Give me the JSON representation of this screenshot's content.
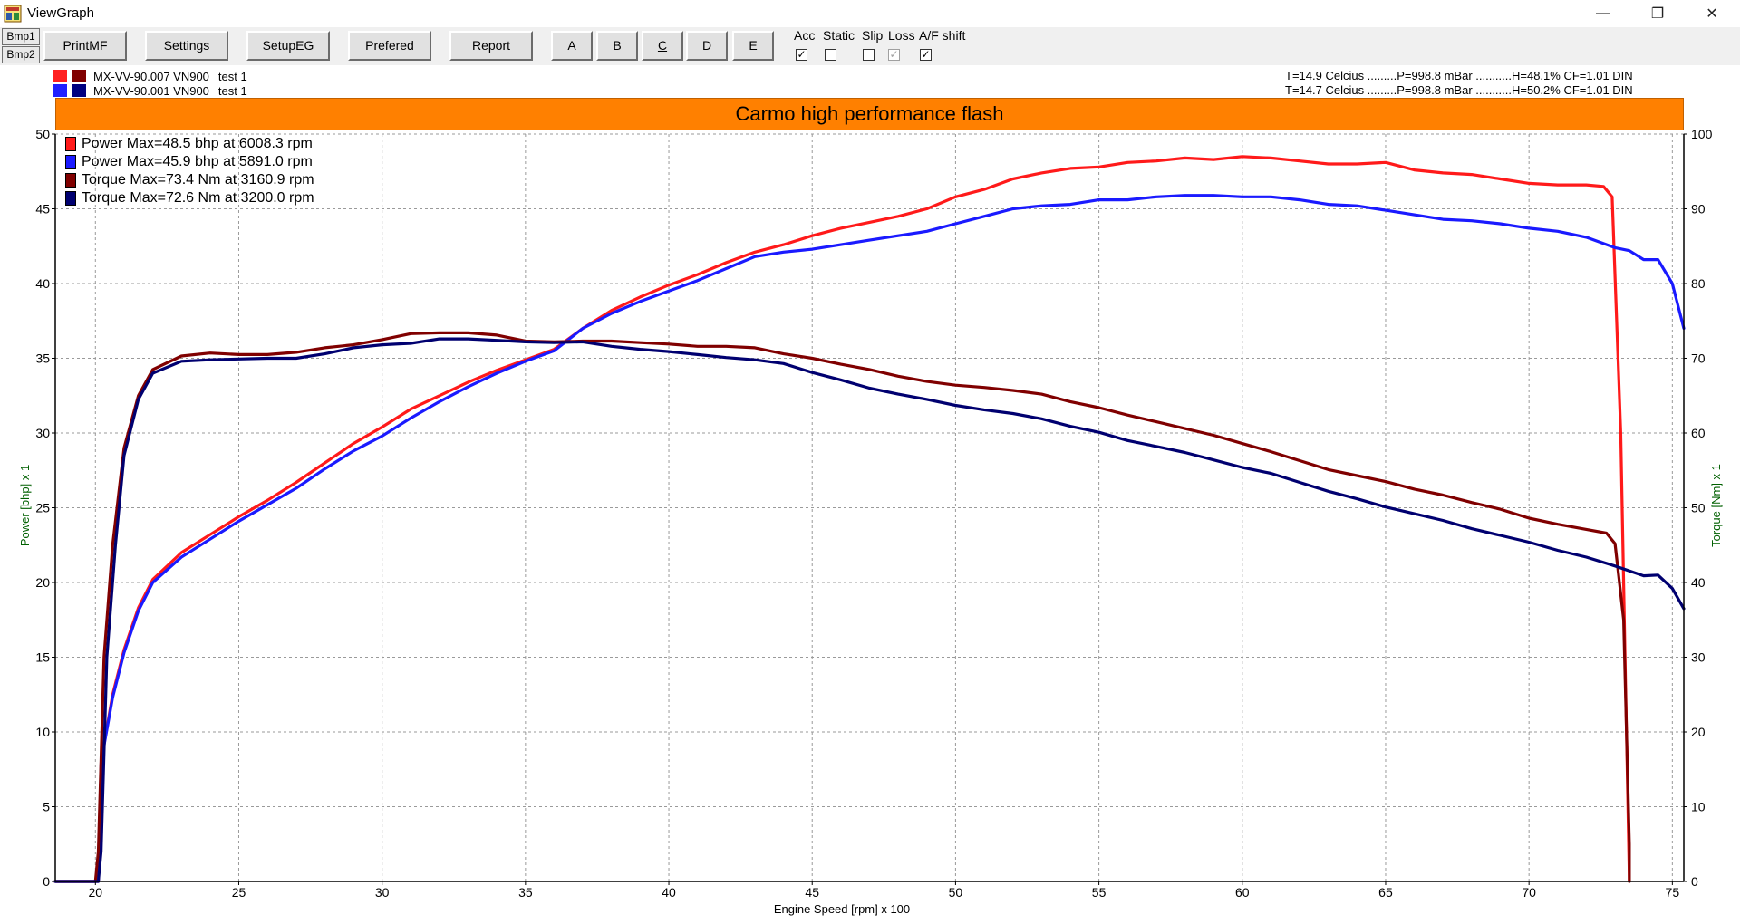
{
  "window": {
    "title": "ViewGraph",
    "min_icon": "minimize-icon",
    "max_icon": "restore-icon",
    "close_icon": "close-icon"
  },
  "toolbar": {
    "tabs": [
      "Bmp1",
      "Bmp2"
    ],
    "buttons": [
      "PrintMF",
      "Settings",
      "SetupEG",
      "Prefered",
      "Report",
      "A",
      "B",
      "C",
      "D",
      "E"
    ],
    "checkboxes": [
      {
        "label": "Acc",
        "checked": true,
        "disabled": false
      },
      {
        "label": "Static",
        "checked": false,
        "disabled": false
      },
      {
        "label": "Slip",
        "checked": false,
        "disabled": false
      },
      {
        "label": "Loss",
        "checked": true,
        "disabled": true
      },
      {
        "label": "A/F shift",
        "checked": true,
        "disabled": false
      }
    ]
  },
  "runs": [
    {
      "label": "MX-VV-90.007 VN900",
      "test": "test 1",
      "colors": [
        "#ff2020",
        "#800000"
      ],
      "conditions": "T=14.9 Celcius .........P=998.8 mBar ...........H=48.1% CF=1.01 DIN"
    },
    {
      "label": "MX-VV-90.001 VN900",
      "test": "test 1",
      "colors": [
        "#2020ff",
        "#000080"
      ],
      "conditions": "T=14.7 Celcius .........P=998.8 mBar ...........H=50.2% CF=1.01 DIN"
    }
  ],
  "chart_data": {
    "type": "line",
    "title": "Carmo high performance flash",
    "xlabel": "Engine Speed [rpm] x 100",
    "ylabel": "Power [bhp] x 1",
    "y2label": "Torque [Nm] x 1",
    "xlim": [
      18.6,
      75.4
    ],
    "ylim": [
      0,
      50
    ],
    "y2lim": [
      0,
      100
    ],
    "x_ticks": [
      20,
      25,
      30,
      35,
      40,
      45,
      50,
      55,
      60,
      65,
      70,
      75
    ],
    "y_ticks": [
      0,
      5,
      10,
      15,
      20,
      25,
      30,
      35,
      40,
      45,
      50
    ],
    "y2_ticks": [
      0,
      10,
      20,
      30,
      40,
      50,
      60,
      70,
      80,
      90,
      100
    ],
    "grid": true,
    "legend_position": "top-left",
    "series": [
      {
        "name": "Power",
        "legend": "Power Max=48.5 bhp at 6008.3 rpm",
        "axis": "left",
        "color": "#ff1a1a",
        "points": [
          [
            18.6,
            0
          ],
          [
            20.1,
            0
          ],
          [
            20.2,
            8
          ],
          [
            20.6,
            12.5
          ],
          [
            21,
            15.5
          ],
          [
            21.5,
            18.3
          ],
          [
            22,
            20.2
          ],
          [
            23,
            22
          ],
          [
            24,
            23.2
          ],
          [
            25,
            24.4
          ],
          [
            26,
            25.5
          ],
          [
            27,
            26.7
          ],
          [
            28,
            28
          ],
          [
            29,
            29.3
          ],
          [
            30,
            30.4
          ],
          [
            31,
            31.6
          ],
          [
            32,
            32.5
          ],
          [
            33,
            33.4
          ],
          [
            34,
            34.2
          ],
          [
            35,
            34.9
          ],
          [
            36,
            35.6
          ],
          [
            37,
            37
          ],
          [
            38,
            38.2
          ],
          [
            39,
            39.1
          ],
          [
            40,
            39.9
          ],
          [
            41,
            40.6
          ],
          [
            42,
            41.4
          ],
          [
            43,
            42.1
          ],
          [
            44,
            42.6
          ],
          [
            45,
            43.2
          ],
          [
            46,
            43.7
          ],
          [
            47,
            44.1
          ],
          [
            48,
            44.5
          ],
          [
            49,
            45
          ],
          [
            50,
            45.8
          ],
          [
            51,
            46.3
          ],
          [
            52,
            47
          ],
          [
            53,
            47.4
          ],
          [
            54,
            47.7
          ],
          [
            55,
            47.8
          ],
          [
            56,
            48.1
          ],
          [
            57,
            48.2
          ],
          [
            58,
            48.4
          ],
          [
            59,
            48.3
          ],
          [
            60,
            48.5
          ],
          [
            61,
            48.4
          ],
          [
            62,
            48.2
          ],
          [
            63,
            48
          ],
          [
            64,
            48
          ],
          [
            65,
            48.1
          ],
          [
            66,
            47.6
          ],
          [
            67,
            47.4
          ],
          [
            68,
            47.3
          ],
          [
            69,
            47
          ],
          [
            70,
            46.7
          ],
          [
            71,
            46.6
          ],
          [
            72,
            46.6
          ],
          [
            72.6,
            46.5
          ],
          [
            72.9,
            45.8
          ],
          [
            73.2,
            30
          ],
          [
            73.5,
            0
          ]
        ]
      },
      {
        "name": "Power",
        "legend": "Power Max=45.9 bhp at 5891.0 rpm",
        "axis": "left",
        "color": "#1a1aff",
        "points": [
          [
            18.6,
            0
          ],
          [
            20.1,
            0
          ],
          [
            20.2,
            8
          ],
          [
            20.6,
            12.3
          ],
          [
            21,
            15.3
          ],
          [
            21.5,
            18.1
          ],
          [
            22,
            20
          ],
          [
            23,
            21.7
          ],
          [
            24,
            22.9
          ],
          [
            25,
            24.1
          ],
          [
            26,
            25.2
          ],
          [
            27,
            26.3
          ],
          [
            28,
            27.6
          ],
          [
            29,
            28.8
          ],
          [
            30,
            29.8
          ],
          [
            31,
            31
          ],
          [
            32,
            32.1
          ],
          [
            33,
            33.1
          ],
          [
            34,
            34
          ],
          [
            35,
            34.8
          ],
          [
            36,
            35.5
          ],
          [
            37,
            37
          ],
          [
            38,
            38
          ],
          [
            39,
            38.8
          ],
          [
            40,
            39.5
          ],
          [
            41,
            40.2
          ],
          [
            42,
            41
          ],
          [
            43,
            41.8
          ],
          [
            44,
            42.1
          ],
          [
            45,
            42.3
          ],
          [
            46,
            42.6
          ],
          [
            47,
            42.9
          ],
          [
            48,
            43.2
          ],
          [
            49,
            43.5
          ],
          [
            50,
            44
          ],
          [
            51,
            44.5
          ],
          [
            52,
            45
          ],
          [
            53,
            45.2
          ],
          [
            54,
            45.3
          ],
          [
            55,
            45.6
          ],
          [
            56,
            45.6
          ],
          [
            57,
            45.8
          ],
          [
            58,
            45.9
          ],
          [
            59,
            45.9
          ],
          [
            60,
            45.8
          ],
          [
            61,
            45.8
          ],
          [
            62,
            45.6
          ],
          [
            63,
            45.3
          ],
          [
            64,
            45.2
          ],
          [
            65,
            44.9
          ],
          [
            66,
            44.6
          ],
          [
            67,
            44.3
          ],
          [
            68,
            44.2
          ],
          [
            69,
            44
          ],
          [
            70,
            43.7
          ],
          [
            71,
            43.5
          ],
          [
            72,
            43.1
          ],
          [
            73,
            42.4
          ],
          [
            73.5,
            42.2
          ],
          [
            74,
            41.6
          ],
          [
            74.5,
            41.6
          ],
          [
            75,
            40
          ],
          [
            75.4,
            37
          ]
        ]
      },
      {
        "name": "Torque",
        "legend": "Torque  Max=73.4 Nm at 3160.9 rpm",
        "axis": "right",
        "color": "#800000",
        "points": [
          [
            18.6,
            0
          ],
          [
            20,
            0
          ],
          [
            20.1,
            4
          ],
          [
            20.3,
            30
          ],
          [
            20.6,
            45
          ],
          [
            21,
            58
          ],
          [
            21.5,
            65
          ],
          [
            22,
            68.5
          ],
          [
            23,
            70.3
          ],
          [
            24,
            70.7
          ],
          [
            25,
            70.5
          ],
          [
            26,
            70.5
          ],
          [
            27,
            70.8
          ],
          [
            28,
            71.4
          ],
          [
            29,
            71.8
          ],
          [
            30,
            72.5
          ],
          [
            31,
            73.3
          ],
          [
            32,
            73.4
          ],
          [
            33,
            73.4
          ],
          [
            34,
            73.1
          ],
          [
            35,
            72.3
          ],
          [
            36,
            72.2
          ],
          [
            37,
            72.3
          ],
          [
            38,
            72.3
          ],
          [
            39,
            72.1
          ],
          [
            40,
            71.9
          ],
          [
            41,
            71.6
          ],
          [
            42,
            71.6
          ],
          [
            43,
            71.4
          ],
          [
            44,
            70.6
          ],
          [
            45,
            70
          ],
          [
            46,
            69.2
          ],
          [
            47,
            68.5
          ],
          [
            48,
            67.6
          ],
          [
            49,
            66.9
          ],
          [
            50,
            66.4
          ],
          [
            51,
            66.1
          ],
          [
            52,
            65.7
          ],
          [
            53,
            65.2
          ],
          [
            54,
            64.2
          ],
          [
            55,
            63.4
          ],
          [
            56,
            62.4
          ],
          [
            57,
            61.5
          ],
          [
            58,
            60.6
          ],
          [
            59,
            59.7
          ],
          [
            60,
            58.6
          ],
          [
            61,
            57.5
          ],
          [
            62,
            56.3
          ],
          [
            63,
            55.1
          ],
          [
            64,
            54.3
          ],
          [
            65,
            53.5
          ],
          [
            66,
            52.5
          ],
          [
            67,
            51.7
          ],
          [
            68,
            50.7
          ],
          [
            69,
            49.8
          ],
          [
            70,
            48.6
          ],
          [
            71,
            47.8
          ],
          [
            72,
            47.1
          ],
          [
            72.7,
            46.6
          ],
          [
            73,
            45.2
          ],
          [
            73.3,
            35
          ],
          [
            73.5,
            5
          ],
          [
            73.5,
            0
          ]
        ]
      },
      {
        "name": "Torque",
        "legend": "Torque  Max=72.6 Nm at 3200.0 rpm",
        "axis": "right",
        "color": "#000070",
        "points": [
          [
            18.6,
            0
          ],
          [
            20.1,
            0
          ],
          [
            20.2,
            4
          ],
          [
            20.4,
            30
          ],
          [
            20.7,
            45
          ],
          [
            21,
            57
          ],
          [
            21.5,
            64.5
          ],
          [
            22,
            68
          ],
          [
            23,
            69.6
          ],
          [
            24,
            69.8
          ],
          [
            25,
            69.9
          ],
          [
            26,
            70
          ],
          [
            27,
            70
          ],
          [
            28,
            70.6
          ],
          [
            29,
            71.4
          ],
          [
            30,
            71.8
          ],
          [
            31,
            72
          ],
          [
            32,
            72.6
          ],
          [
            33,
            72.6
          ],
          [
            34,
            72.4
          ],
          [
            35,
            72.2
          ],
          [
            36,
            72.1
          ],
          [
            37,
            72.2
          ],
          [
            38,
            71.6
          ],
          [
            39,
            71.2
          ],
          [
            40,
            70.9
          ],
          [
            41,
            70.5
          ],
          [
            42,
            70.1
          ],
          [
            43,
            69.8
          ],
          [
            44,
            69.3
          ],
          [
            45,
            68.1
          ],
          [
            46,
            67.1
          ],
          [
            47,
            66
          ],
          [
            48,
            65.2
          ],
          [
            49,
            64.5
          ],
          [
            50,
            63.7
          ],
          [
            51,
            63.1
          ],
          [
            52,
            62.6
          ],
          [
            53,
            61.9
          ],
          [
            54,
            60.9
          ],
          [
            55,
            60.1
          ],
          [
            56,
            59
          ],
          [
            57,
            58.2
          ],
          [
            58,
            57.4
          ],
          [
            59,
            56.4
          ],
          [
            60,
            55.4
          ],
          [
            61,
            54.6
          ],
          [
            62,
            53.4
          ],
          [
            63,
            52.2
          ],
          [
            64,
            51.2
          ],
          [
            65,
            50.1
          ],
          [
            66,
            49.2
          ],
          [
            67,
            48.3
          ],
          [
            68,
            47.2
          ],
          [
            69,
            46.3
          ],
          [
            70,
            45.4
          ],
          [
            71,
            44.3
          ],
          [
            72,
            43.4
          ],
          [
            73,
            42.2
          ],
          [
            74,
            40.9
          ],
          [
            74.5,
            41
          ],
          [
            75,
            39.2
          ],
          [
            75.4,
            36.5
          ]
        ]
      }
    ]
  }
}
